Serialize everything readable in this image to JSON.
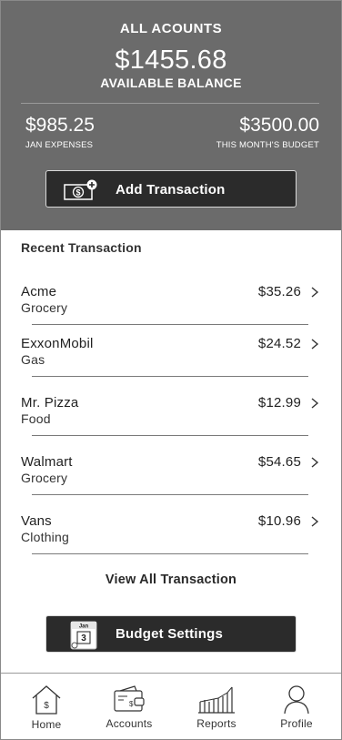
{
  "header": {
    "title": "ALL ACOUNTS",
    "balance": "$1455.68",
    "balance_label": "AVAILABLE BALANCE",
    "expenses_value": "$985.25",
    "expenses_label": "JAN EXPENSES",
    "budget_value": "$3500.00",
    "budget_label": "THIS MONTH'S BUDGET"
  },
  "actions": {
    "add_transaction": "Add Transaction",
    "budget_settings": "Budget Settings",
    "calendar_month": "Jan",
    "calendar_day": "3",
    "cash_symbol": "$"
  },
  "recent": {
    "title": "Recent Transaction",
    "items": [
      {
        "name": "Acme",
        "category": "Grocery",
        "amount": "$35.26"
      },
      {
        "name": "ExxonMobil",
        "category": "Gas",
        "amount": "$24.52"
      },
      {
        "name": "Mr. Pizza",
        "category": "Food",
        "amount": "$12.99"
      },
      {
        "name": "Walmart",
        "category": "Grocery",
        "amount": "$54.65"
      },
      {
        "name": "Vans",
        "category": "Clothing",
        "amount": "$10.96"
      }
    ],
    "view_all": "View All Transaction"
  },
  "nav": {
    "home": "Home",
    "home_symbol": "$",
    "accounts": "Accounts",
    "accounts_symbol": "$",
    "reports": "Reports",
    "profile": "Profile",
    "active": "home"
  },
  "colors": {
    "header_bg": "#6b6b6b",
    "button_bg": "#2b2b2b"
  }
}
